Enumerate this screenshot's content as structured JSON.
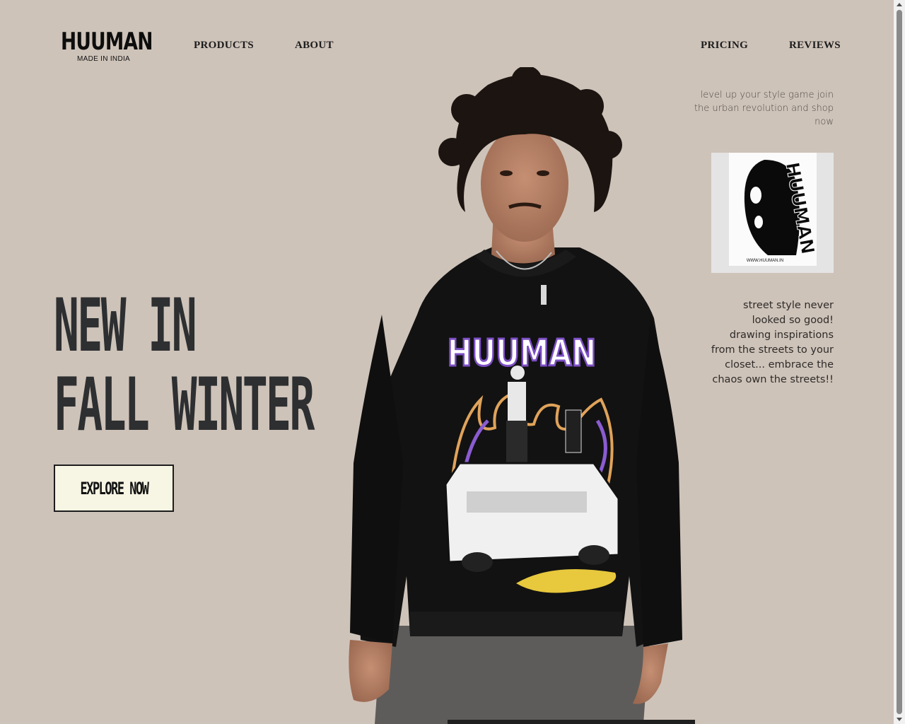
{
  "brand": {
    "name": "HUUMAN",
    "tagline": "MADE IN INDIA"
  },
  "nav": {
    "products": "PRODUCTS",
    "about": "ABOUT",
    "pricing": "PRICING",
    "reviews": "REVIEWS"
  },
  "hero": {
    "line1": "NEW IN",
    "line2": "FALL WINTER",
    "cta": "EXPLORE NOW"
  },
  "side": {
    "tagline": "level up your style game join the urban revolution and shop now",
    "description": "street style never looked so good! drawing inspirations from the streets to your closet... embrace the chaos own the streets!!",
    "card_word": "HUUMAN",
    "card_url": "WWW.HUUMAN.IN"
  },
  "sweater_print": "HUUMAN",
  "colors": {
    "background": "#cec3b9",
    "hero_text": "#2d2f31",
    "button_bg": "#f7f5e3",
    "print_purple": "#7c4fc4"
  }
}
